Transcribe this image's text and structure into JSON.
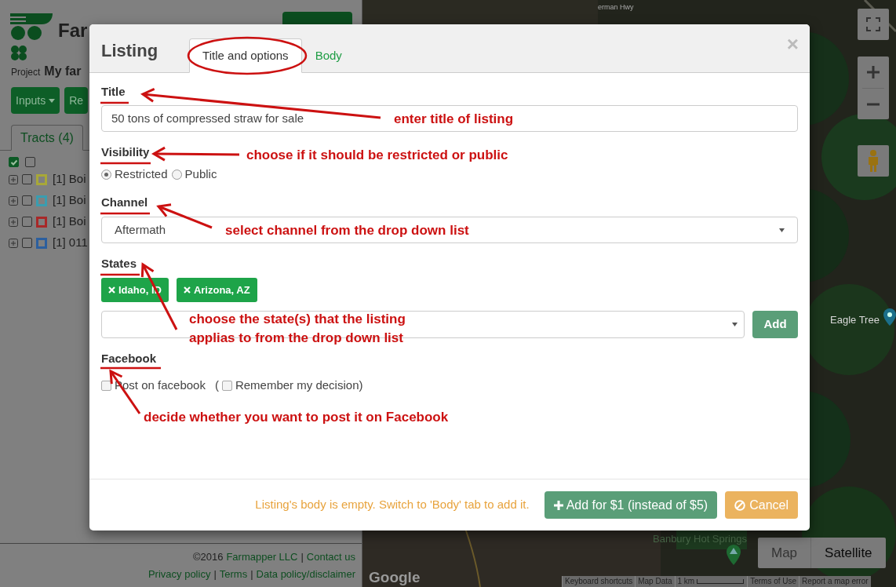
{
  "app": {
    "logo_text": "Far",
    "project_label": "Project",
    "project_name": "My far",
    "buttons": [
      {
        "label": "Inputs",
        "caret": true
      },
      {
        "label": "Re",
        "caret": false
      }
    ],
    "tabs": [
      {
        "label": "Tracts (4)",
        "selected": true
      }
    ],
    "bulk_checks": [
      {
        "checked": true
      },
      {
        "checked": false
      }
    ],
    "tracts": [
      {
        "label": "[1] Boi",
        "checked": false,
        "color": "#a8a838"
      },
      {
        "label": "[1] Boi",
        "checked": false,
        "color": "#3a9db0"
      },
      {
        "label": "[1] Boi",
        "checked": false,
        "color": "#a82828"
      },
      {
        "label": "[1] 011",
        "checked": false,
        "color": "#2c5f9e"
      }
    ],
    "footer": {
      "line_1": [
        {
          "text": "©2016",
          "link": false
        },
        {
          "text": "Farmapper LLC",
          "link": true
        },
        {
          "text": "|",
          "link": false
        },
        {
          "text": "Contact us",
          "link": true
        }
      ],
      "line_2": [
        {
          "text": "Privacy policy",
          "link": true
        },
        {
          "text": "|",
          "link": false
        },
        {
          "text": "Terms",
          "link": true
        },
        {
          "text": "|",
          "link": false
        },
        {
          "text": "Data policy/disclaimer",
          "link": true
        }
      ]
    }
  },
  "map": {
    "road_label": "erman Hwy",
    "places": [
      "Eagle Tree",
      "Banbury Hot Springs"
    ],
    "map_types": [
      {
        "label": "Map",
        "selected": false
      },
      {
        "label": "Satellite",
        "selected": true
      }
    ],
    "logo": "Google",
    "attribution": [
      "Keyboard shortcuts",
      "Map Data",
      "1 km",
      "Terms of Use",
      "Report a map error"
    ]
  },
  "dialog": {
    "title": "Listing",
    "close": "×",
    "tabs": [
      {
        "label": "Title and options",
        "selected": true
      },
      {
        "label": "Body",
        "selected": false
      }
    ],
    "title_field": {
      "label": "Title",
      "value": "50 tons of compressed straw for sale"
    },
    "visibility": {
      "label": "Visibility",
      "options": [
        {
          "label": "Restricted",
          "selected": true
        },
        {
          "label": "Public",
          "selected": false
        }
      ]
    },
    "channel": {
      "label": "Channel",
      "value": "Aftermath"
    },
    "states": {
      "label": "States",
      "tags": [
        {
          "label": "Idaho, ID"
        },
        {
          "label": "Arizona, AZ"
        }
      ],
      "add_button": "Add"
    },
    "facebook": {
      "label": "Facebook",
      "post": {
        "label": "Post on facebook",
        "checked": false
      },
      "open_paren": "(",
      "remember": {
        "label": "Remember my decision",
        "checked": false
      },
      "close_paren": ")"
    },
    "footer": {
      "warning": "Listing's body is empty. Switch to 'Body' tab to add it.",
      "submit": "Add for $1 (instead of $5)",
      "cancel": "Cancel"
    }
  },
  "annotations": [
    {
      "text": "enter title of listing"
    },
    {
      "text": "choose if it should be restricted or public"
    },
    {
      "text": "select channel from the drop down list"
    },
    {
      "text": "choose the state(s) that the listing applias to from the drop down list"
    },
    {
      "text": "decide whether you want to post it on Facebook"
    }
  ]
}
